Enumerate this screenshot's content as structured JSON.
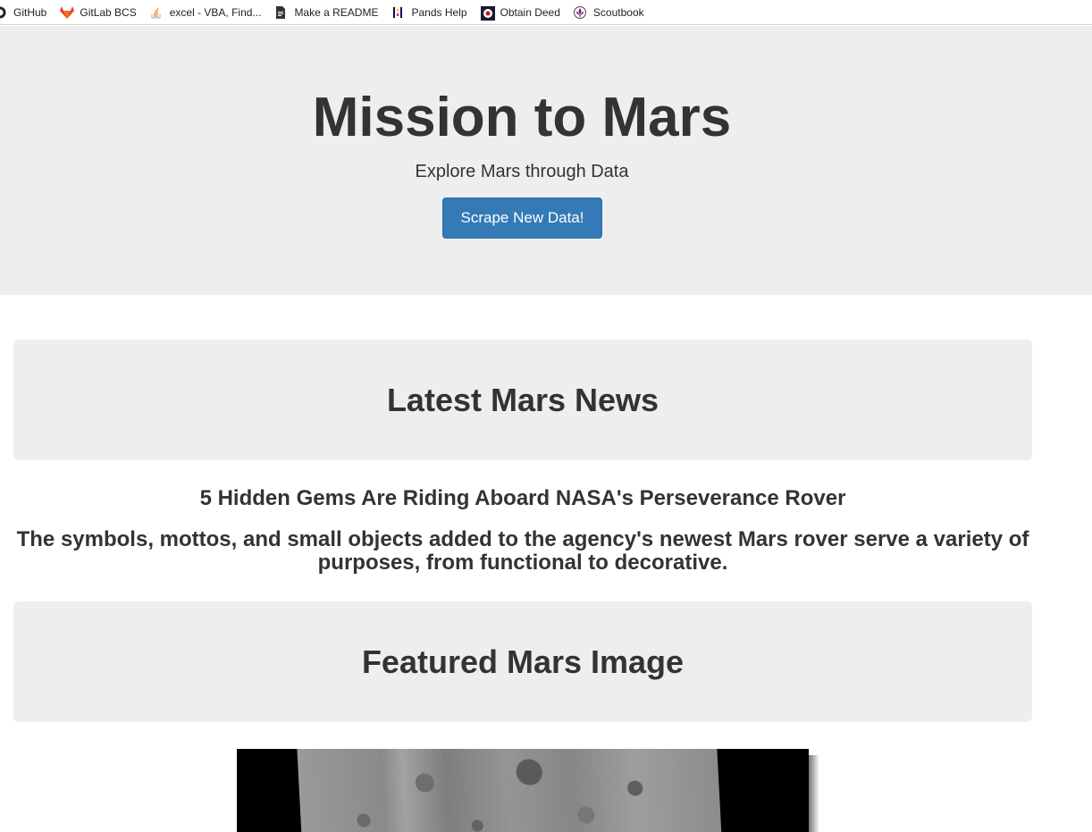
{
  "bookmarks": [
    {
      "label": "GitHub",
      "icon": "github-icon"
    },
    {
      "label": "GitLab BCS",
      "icon": "gitlab-icon"
    },
    {
      "label": "excel - VBA, Find...",
      "icon": "stackoverflow-icon"
    },
    {
      "label": "Make a README",
      "icon": "document-icon"
    },
    {
      "label": "Pands Help",
      "icon": "pandas-icon"
    },
    {
      "label": "Obtain Deed",
      "icon": "target-icon"
    },
    {
      "label": "Scoutbook",
      "icon": "fleur-de-lis-icon"
    }
  ],
  "header": {
    "title": "Mission to Mars",
    "subtitle": "Explore Mars through Data",
    "button_label": "Scrape New Data!"
  },
  "news": {
    "section_title": "Latest Mars News",
    "headline": "5 Hidden Gems Are Riding Aboard NASA's Perseverance Rover",
    "teaser": "The symbols, mottos, and small objects added to the agency's newest Mars rover serve a variety of purposes, from functional to decorative."
  },
  "featured": {
    "section_title": "Featured Mars Image"
  },
  "colors": {
    "jumbotron_bg": "#eeeeee",
    "button_bg": "#337ab7",
    "text": "#333333"
  }
}
